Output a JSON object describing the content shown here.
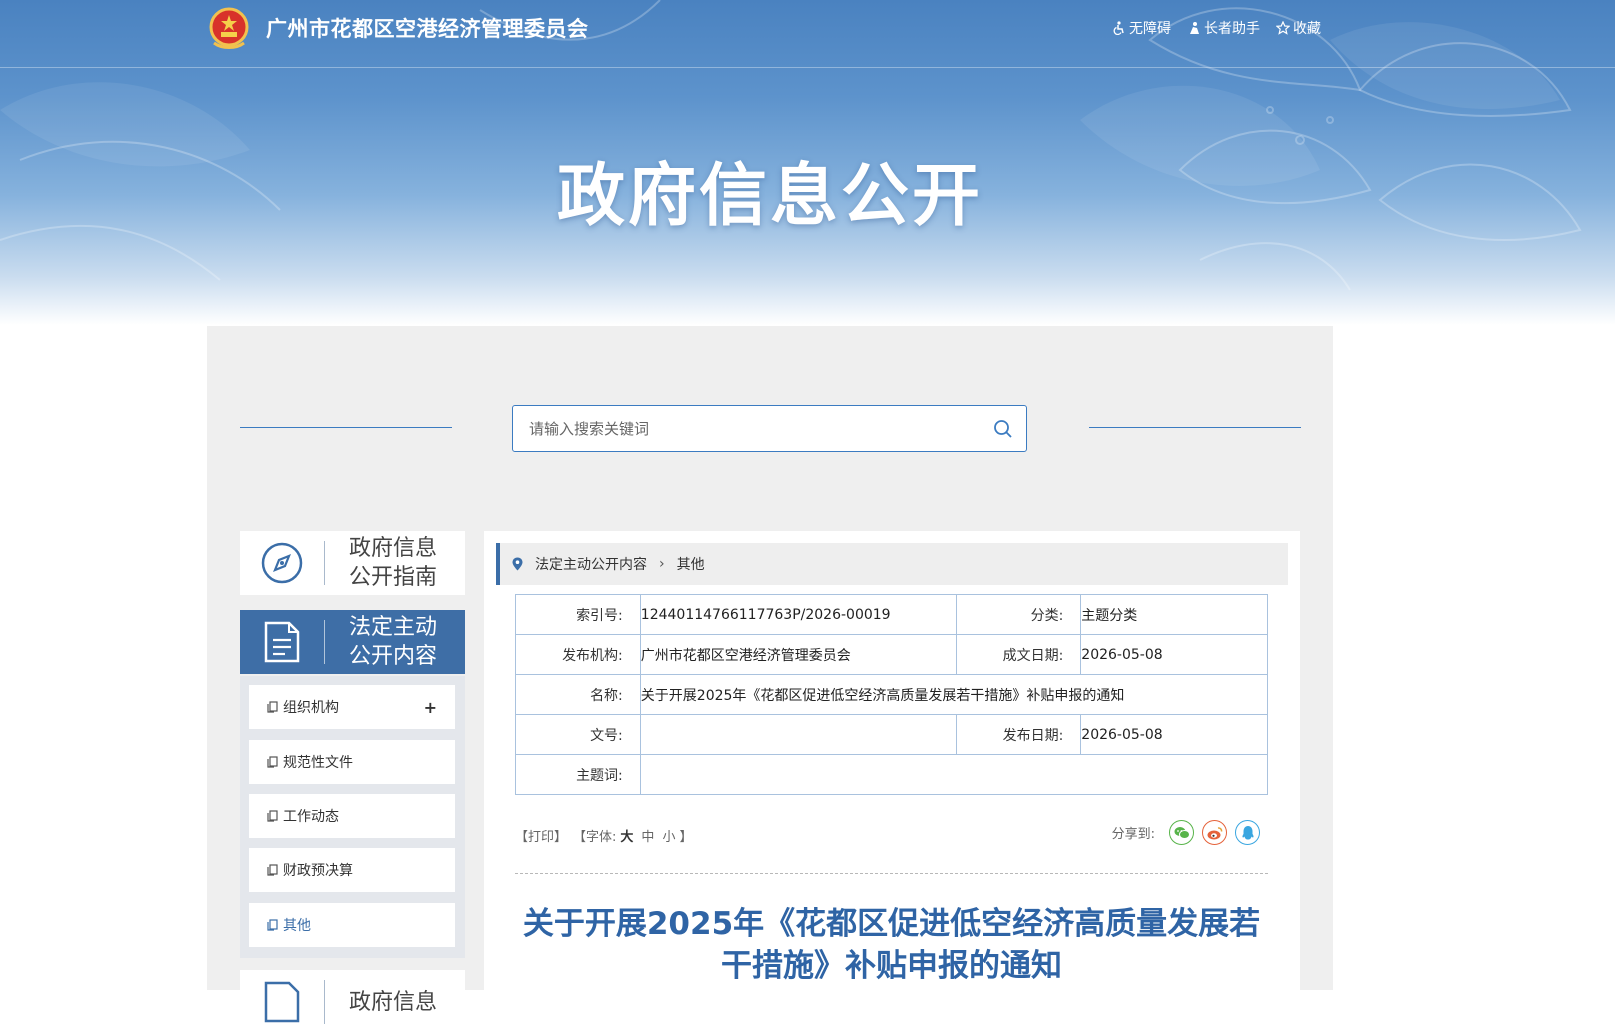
{
  "header": {
    "site_title": "广州市花都区空港经济管理委员会",
    "links": {
      "accessibility": "无障碍",
      "elder": "长者助手",
      "favorite": "收藏"
    },
    "hero_title": "政府信息公开"
  },
  "search": {
    "placeholder": "请输入搜索关键词",
    "icon": "search-icon"
  },
  "sidebar": {
    "cards": [
      {
        "label_line1": "政府信息",
        "label_line2": "公开指南",
        "icon": "compass-icon"
      },
      {
        "label_line1": "法定主动",
        "label_line2": "公开内容",
        "icon": "document-icon",
        "active": true
      },
      {
        "label_line1": "政府信息",
        "label_line2": "",
        "icon": "document-icon"
      }
    ],
    "sub_items": [
      {
        "label": "组织机构",
        "expand": "+"
      },
      {
        "label": "规范性文件"
      },
      {
        "label": "工作动态"
      },
      {
        "label": "财政预决算"
      },
      {
        "label": "其他",
        "current": true
      }
    ]
  },
  "breadcrumb": {
    "parent": "法定主动公开内容",
    "current": "其他"
  },
  "meta": {
    "index_no_label": "索引号:",
    "index_no": "12440114766117763P/2026-00019",
    "category_label": "分类:",
    "category": "主题分类",
    "publisher_label": "发布机构:",
    "publisher": "广州市花都区空港经济管理委员会",
    "created_label": "成文日期:",
    "created": "2026-05-08",
    "name_label": "名称:",
    "name": "关于开展2025年《花都区促进低空经济高质量发展若干措施》补贴申报的通知",
    "doc_no_label": "文号:",
    "doc_no": "",
    "published_label": "发布日期:",
    "published": "2026-05-08",
    "keywords_label": "主题词:",
    "keywords": ""
  },
  "tools": {
    "print": "【打印】",
    "font_prefix": "【字体:",
    "font_large": "大",
    "font_medium": "中",
    "font_small": "小",
    "font_suffix": "】",
    "share_label": "分享到:",
    "share_icons": [
      "wechat-icon",
      "weibo-icon",
      "qq-icon"
    ],
    "share_colors": {
      "wechat": "#58b44a",
      "weibo": "#e5623a",
      "qq": "#3aa6e0"
    }
  },
  "article": {
    "title": "关于开展2025年《花都区促进低空经济高质量发展若干措施》补贴申报的通知"
  },
  "colors": {
    "accent": "#3b6ea8",
    "title_blue": "#2f64a5",
    "panel_bg": "#efefef"
  }
}
